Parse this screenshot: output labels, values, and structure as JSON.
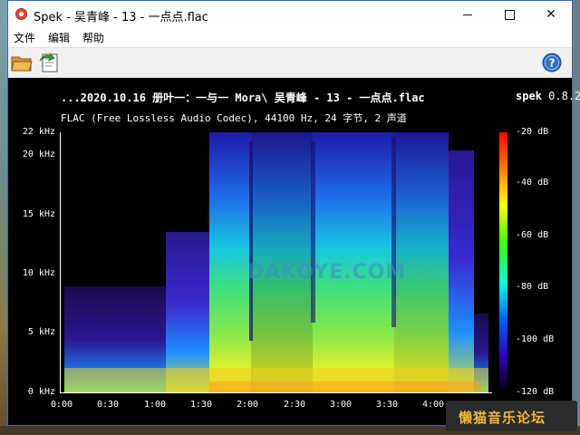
{
  "window": {
    "title": "Spek - 吴青峰 - 13 - 一点点.flac",
    "min_icon": "minimize-icon",
    "max_icon": "maximize-icon",
    "close_label": "✕"
  },
  "menu": {
    "file": "文件",
    "edit": "编辑",
    "help": "帮助"
  },
  "toolbar": {
    "open_icon": "folder-open-icon",
    "save_icon": "save-icon",
    "help_icon": "help-icon",
    "help_label": "?"
  },
  "spectrogram": {
    "file_title": "...2020.10.16 册叶一：一与一  Mora\\ 吴青峰  - 13 - 一点点.flac",
    "app_name": "spek",
    "app_version": "0.8.2",
    "file_info": "FLAC (Free Lossless Audio Codec), 44100 Hz, 24 字节, 2 声道",
    "watermark": "DAKOYE.COM",
    "y_ticks": [
      "22 kHz",
      "20 kHz",
      "15 kHz",
      "10 kHz",
      "5 kHz",
      "0 kHz"
    ],
    "x_ticks": [
      "0:00",
      "0:30",
      "1:00",
      "1:30",
      "2:00",
      "2:30",
      "3:00",
      "3:30",
      "4:00"
    ],
    "db_ticks": [
      "-20 dB",
      "-40 dB",
      "-60 dB",
      "-80 dB",
      "-100 dB",
      "-120 dB"
    ],
    "colors": {
      "hot": "#ff0000",
      "mid": "#ffff00",
      "low": "#40ff00",
      "cool": "#0060ff",
      "floor": "#000000"
    }
  },
  "brand": {
    "text": "懒猫音乐论坛"
  }
}
